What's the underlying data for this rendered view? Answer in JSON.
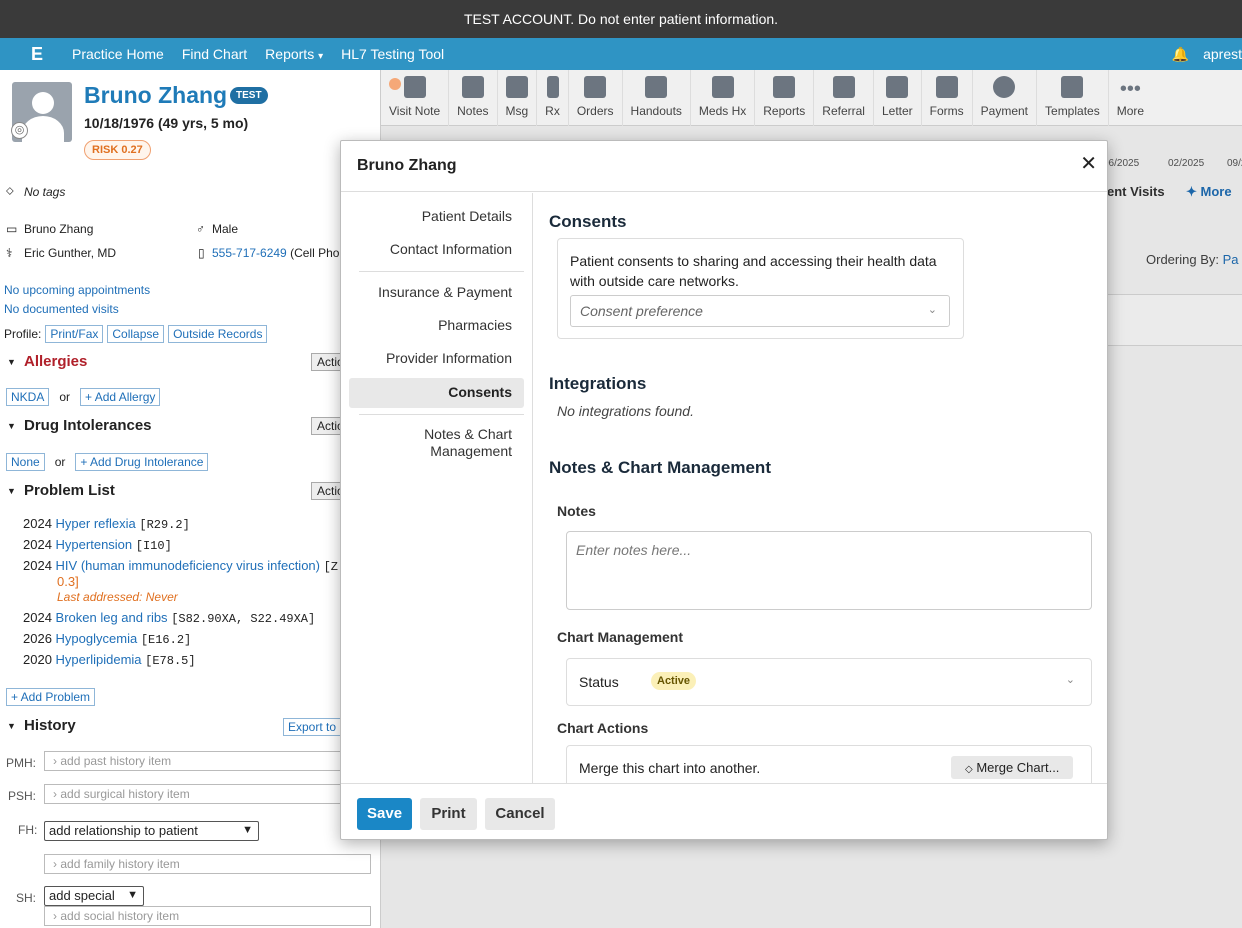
{
  "banner": "TEST ACCOUNT. Do not enter patient information.",
  "nav": {
    "items": [
      "Practice Home",
      "Find Chart",
      "Reports",
      "HL7 Testing Tool"
    ],
    "reports_chevron": "⌄",
    "user": "aprest"
  },
  "patient": {
    "name": "Bruno Zhang",
    "badge": "TEST",
    "dob": "10/18/1976 (49 yrs, 5 mo)",
    "risk": "RISK 0.27",
    "tags": "No tags",
    "demo_name": "Bruno Zhang",
    "sex": "Male",
    "provider": "Eric Gunther, MD",
    "phone": "555-717-6249",
    "phone_type": "(Cell Pho",
    "appointments": "No upcoming appointments",
    "visits": "No documented visits",
    "profile_label": "Profile:",
    "profile_buttons": [
      "Print/Fax",
      "Collapse",
      "Outside Records"
    ]
  },
  "allergies": {
    "title": "Allergies",
    "action": "Actio",
    "nkda": "NKDA",
    "or": "or",
    "add": "+ Add Allergy"
  },
  "intolerances": {
    "title": "Drug Intolerances",
    "action": "Actio",
    "none": "None",
    "or": "or",
    "add": "+ Add Drug Intolerance"
  },
  "problems": {
    "title": "Problem List",
    "action": "Actio",
    "items": [
      {
        "year": "2024",
        "name": "Hyper reflexia",
        "code": "[R29.2]"
      },
      {
        "year": "2024",
        "name": "Hypertension",
        "code": "[I10]"
      },
      {
        "year": "2024",
        "name": "HIV (human immunodeficiency virus infection)",
        "code": "[Z",
        "code2": "0.3]",
        "note": "Last addressed: Never"
      },
      {
        "year": "2024",
        "name": "Broken leg and ribs",
        "code": "[S82.90XA, S22.49XA]"
      },
      {
        "year": "2026",
        "name": "Hypoglycemia",
        "code": "[E16.2]"
      },
      {
        "year": "2020",
        "name": "Hyperlipidemia",
        "code": "[E78.5]"
      }
    ],
    "add": "+ Add Problem"
  },
  "history": {
    "title": "History",
    "export": "Export to",
    "pmh_label": "PMH:",
    "pmh": "add past history item",
    "psh_label": "PSH:",
    "psh": "add surgical history item",
    "fh_label": "FH:",
    "fh_select": "add relationship to patient",
    "fh": "add family history item",
    "sh_label": "SH:",
    "sh_select": "add special",
    "sh": "add social history item"
  },
  "toolbar": [
    "Visit Note",
    "Notes",
    "Msg",
    "Rx",
    "Orders",
    "Handouts",
    "Meds Hx",
    "Reports",
    "Referral",
    "Letter",
    "Forms",
    "Payment",
    "Templates",
    "More"
  ],
  "background": {
    "dates": [
      "06/2025",
      "02/2025",
      "09/2"
    ],
    "visits": "ent Visits",
    "more": "More",
    "ordering": "Ordering By:",
    "ordering_val": "Pa"
  },
  "modal": {
    "title": "Bruno Zhang",
    "close": "✕",
    "nav": [
      "Patient Details",
      "Contact Information",
      "Insurance & Payment",
      "Pharmacies",
      "Provider Information",
      "Consents",
      "Notes & Chart Management"
    ],
    "consents_title": "Consents",
    "consent_text": "Patient consents to sharing and accessing their health data with outside care networks.",
    "consent_placeholder": "Consent preference",
    "integrations_title": "Integrations",
    "integrations_empty": "No integrations found.",
    "notes_section_title": "Notes & Chart Management",
    "notes_label": "Notes",
    "notes_placeholder": "Enter notes here...",
    "chart_mgmt_label": "Chart Management",
    "status_label": "Status",
    "status_value": "Active",
    "chart_actions_label": "Chart Actions",
    "merge_text": "Merge this chart into another.",
    "merge_button": "Merge Chart...",
    "save": "Save",
    "print": "Print",
    "cancel": "Cancel"
  },
  "colors": {
    "accent": "#2f94c4",
    "save": "#1a87c6",
    "link": "#1f6fb8",
    "allergy": "#b0202a"
  }
}
